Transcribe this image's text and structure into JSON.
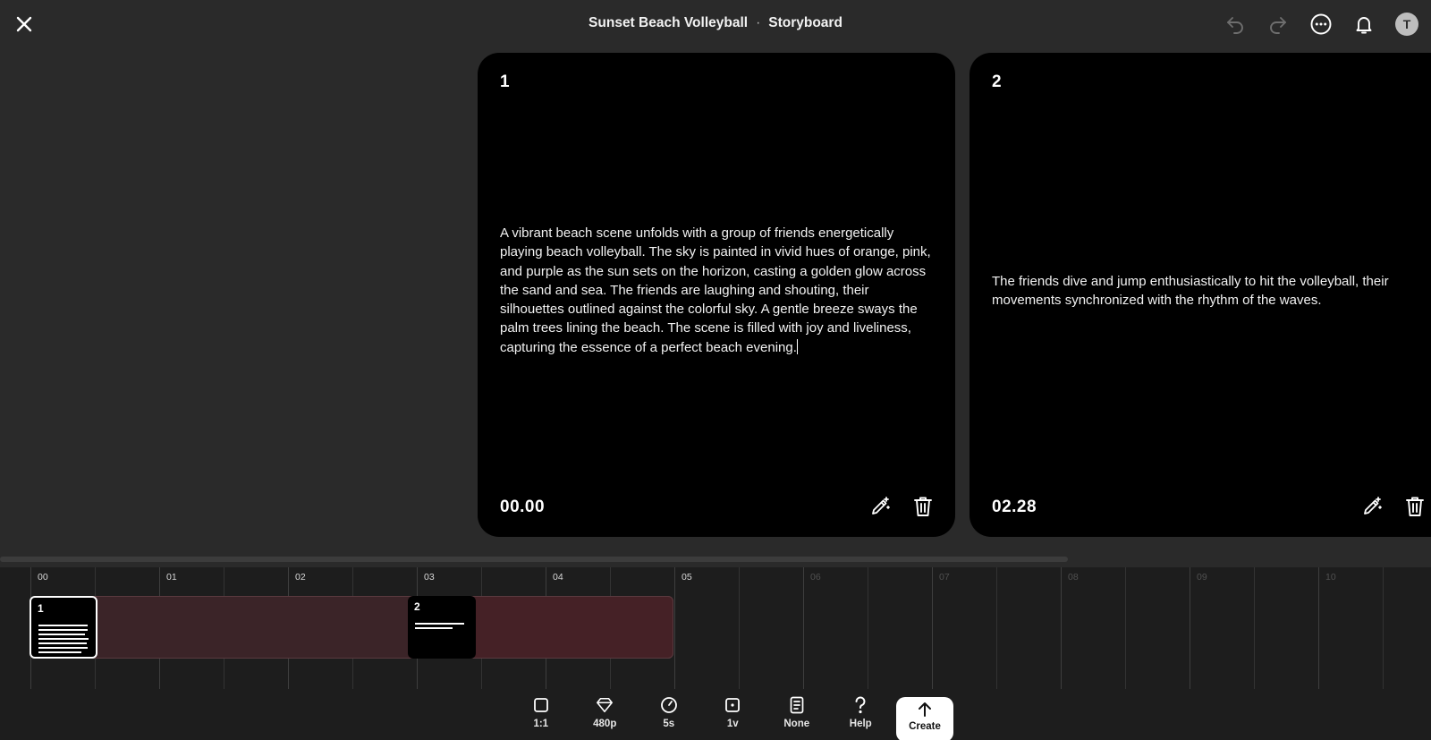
{
  "header": {
    "project_title": "Sunset Beach Volleyball",
    "separator": "·",
    "view_name": "Storyboard",
    "avatar_initial": "T"
  },
  "scenes": [
    {
      "number": "1",
      "description": "A vibrant beach scene unfolds with a group of friends energetically playing beach volleyball. The sky is painted in vivid hues of orange, pink, and purple as the sun sets on the horizon, casting a golden glow across the sand and sea. The friends are laughing and shouting, their silhouettes outlined against the colorful sky. A gentle breeze sways the palm trees lining the beach. The scene is filled with joy and liveliness, capturing the essence of a perfect beach evening.",
      "time": "00.00"
    },
    {
      "number": "2",
      "description": "The friends dive and jump enthusiastically to hit the volleyball, their movements synchronized with the rhythm of the waves.",
      "time": "02.28"
    }
  ],
  "timeline": {
    "labels": [
      "00",
      "01",
      "02",
      "03",
      "04",
      "05",
      "06",
      "07",
      "08",
      "09",
      "10"
    ],
    "active_seconds": 5,
    "clips": [
      {
        "number": "1",
        "start_seconds": 0.0
      },
      {
        "number": "2",
        "start_seconds": 2.28
      }
    ]
  },
  "toolbar": {
    "aspect_label": "1:1",
    "quality_label": "480p",
    "duration_label": "5s",
    "variations_label": "1v",
    "style_label": "None",
    "help_label": "Help",
    "create_label": "Create"
  },
  "colors": {
    "background": "#2a2a2a",
    "card": "#000000",
    "timeline_bg": "#1d1d1d",
    "track": "#3b2428",
    "create_button": "#ffffff"
  }
}
